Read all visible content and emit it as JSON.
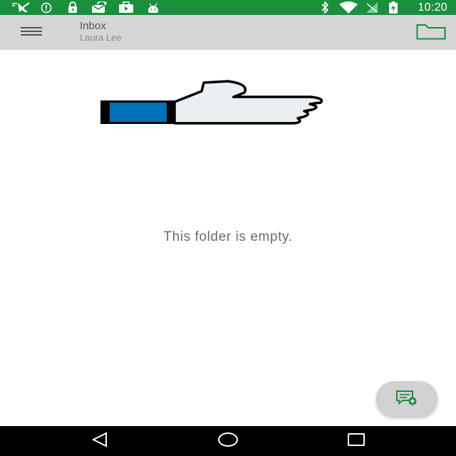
{
  "status_bar": {
    "time": "10:20",
    "background_color": "#1a8f3c",
    "left_icons": [
      "mouse-pointer-icon",
      "info-icon",
      "lock-icon",
      "mail-sync-icon",
      "briefcase-icon",
      "android-icon"
    ],
    "right_icons": [
      "bluetooth-icon",
      "wifi-icon",
      "signal-icon",
      "battery-charging-icon"
    ]
  },
  "toolbar": {
    "title": "Inbox",
    "subtitle": "Laura Lee",
    "background_color": "#d6d6d6",
    "menu_icon": "hamburger-menu-icon",
    "folder_icon": "folder-icon",
    "accent_color": "#1a8f3c"
  },
  "content": {
    "illustration": "thumbs-up-illustration",
    "empty_message": "This folder is empty."
  },
  "fab": {
    "icon": "compose-message-icon"
  },
  "nav_bar": {
    "icons": [
      "back-icon",
      "home-icon",
      "recents-icon"
    ]
  }
}
